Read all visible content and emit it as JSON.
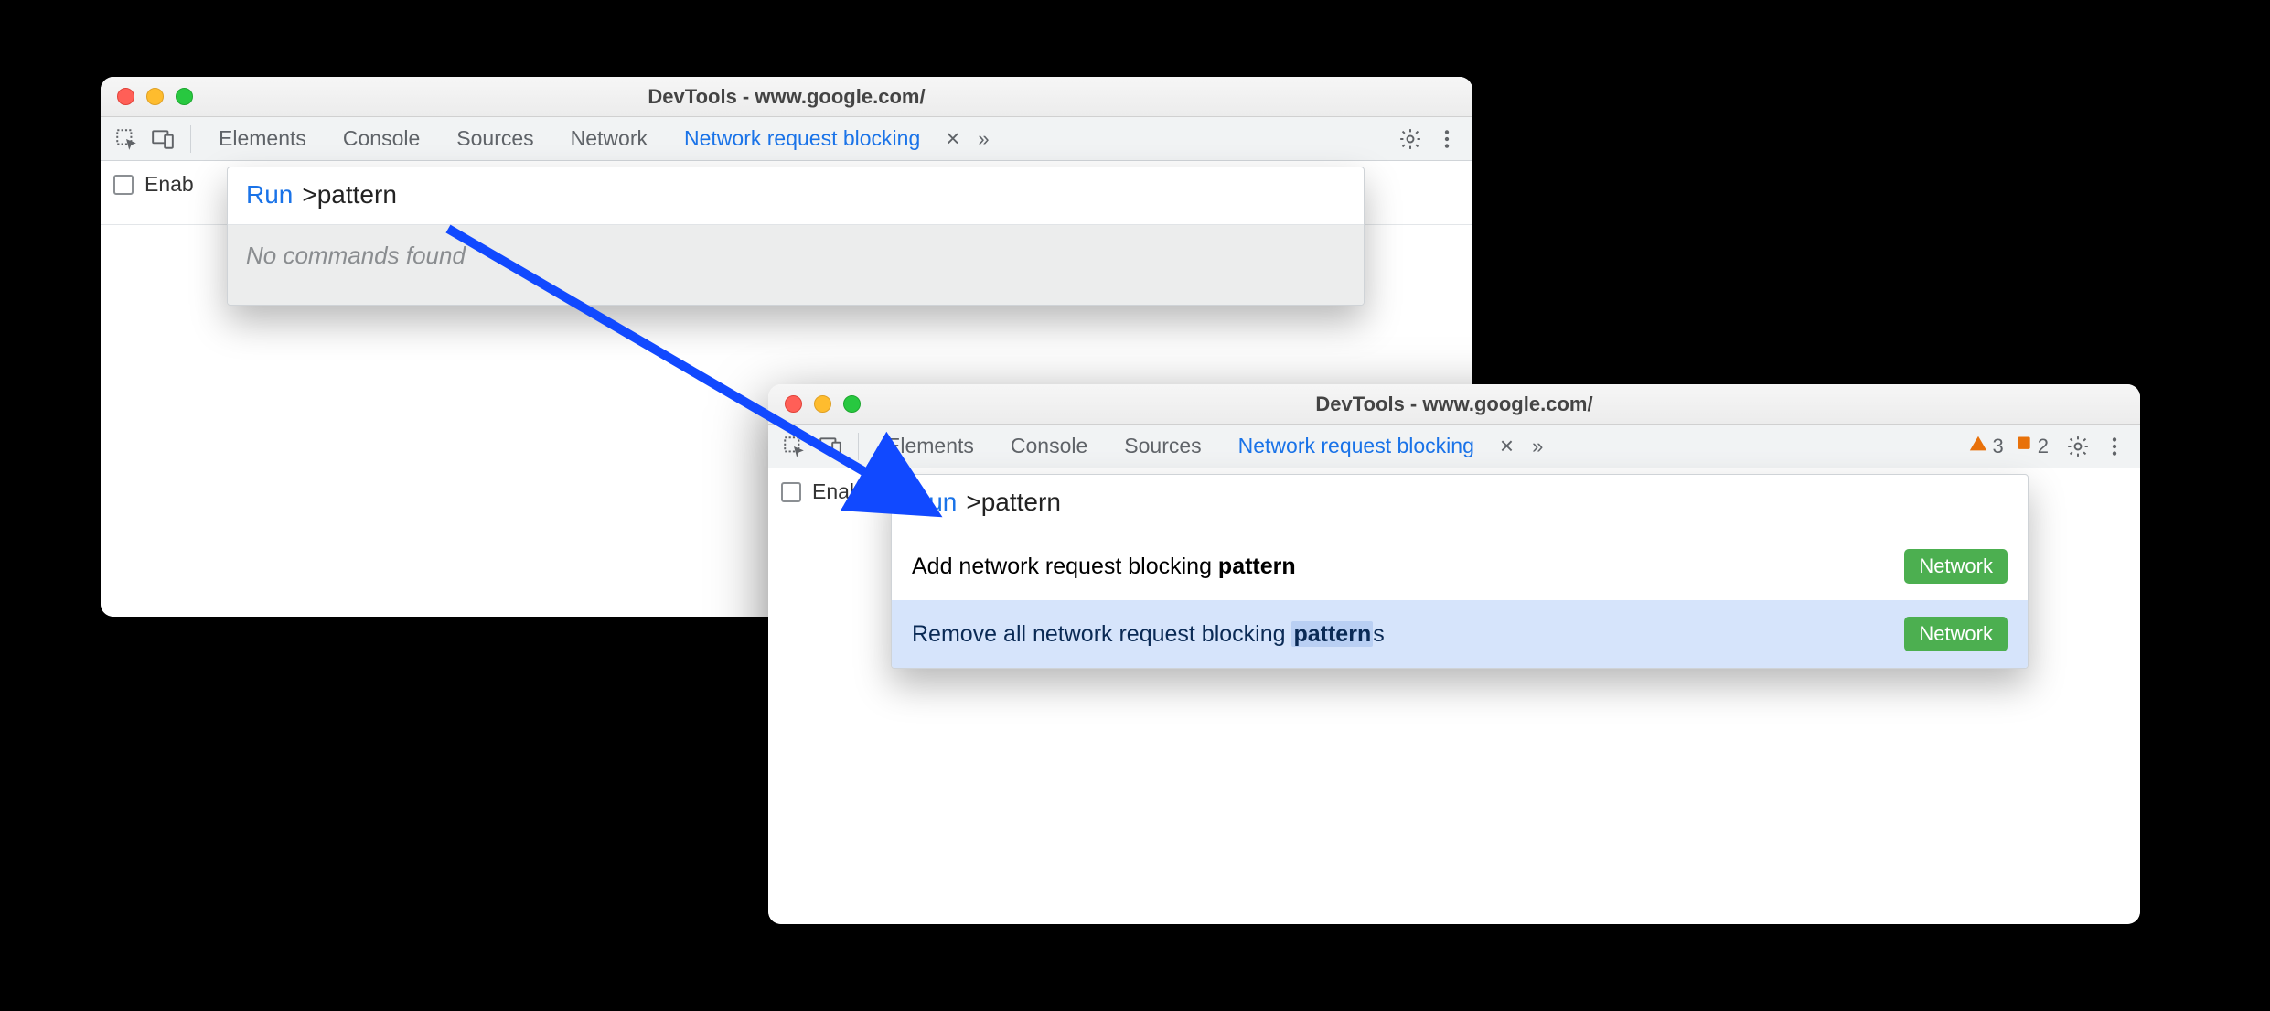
{
  "window1": {
    "title": "DevTools - www.google.com/",
    "tabs": [
      "Elements",
      "Console",
      "Sources",
      "Network",
      "Network request blocking"
    ],
    "active_tab_index": 4,
    "checkbox_label_partial": "Enab",
    "palette": {
      "run_label": "Run",
      "query": ">pattern",
      "no_results": "No commands found"
    }
  },
  "window2": {
    "title": "DevTools - www.google.com/",
    "tabs": [
      "Elements",
      "Console",
      "Sources",
      "Network request blocking"
    ],
    "active_tab_index": 3,
    "checkbox_label_partial": "Enab",
    "warning_count": "3",
    "issue_count": "2",
    "palette": {
      "run_label": "Run",
      "query": ">pattern",
      "badge": "Network",
      "results": [
        {
          "prefix": "Add network request blocking ",
          "match": "pattern",
          "suffix": ""
        },
        {
          "prefix": "Remove all network request blocking ",
          "match": "pattern",
          "suffix": "s",
          "highlighted": true
        }
      ]
    }
  }
}
